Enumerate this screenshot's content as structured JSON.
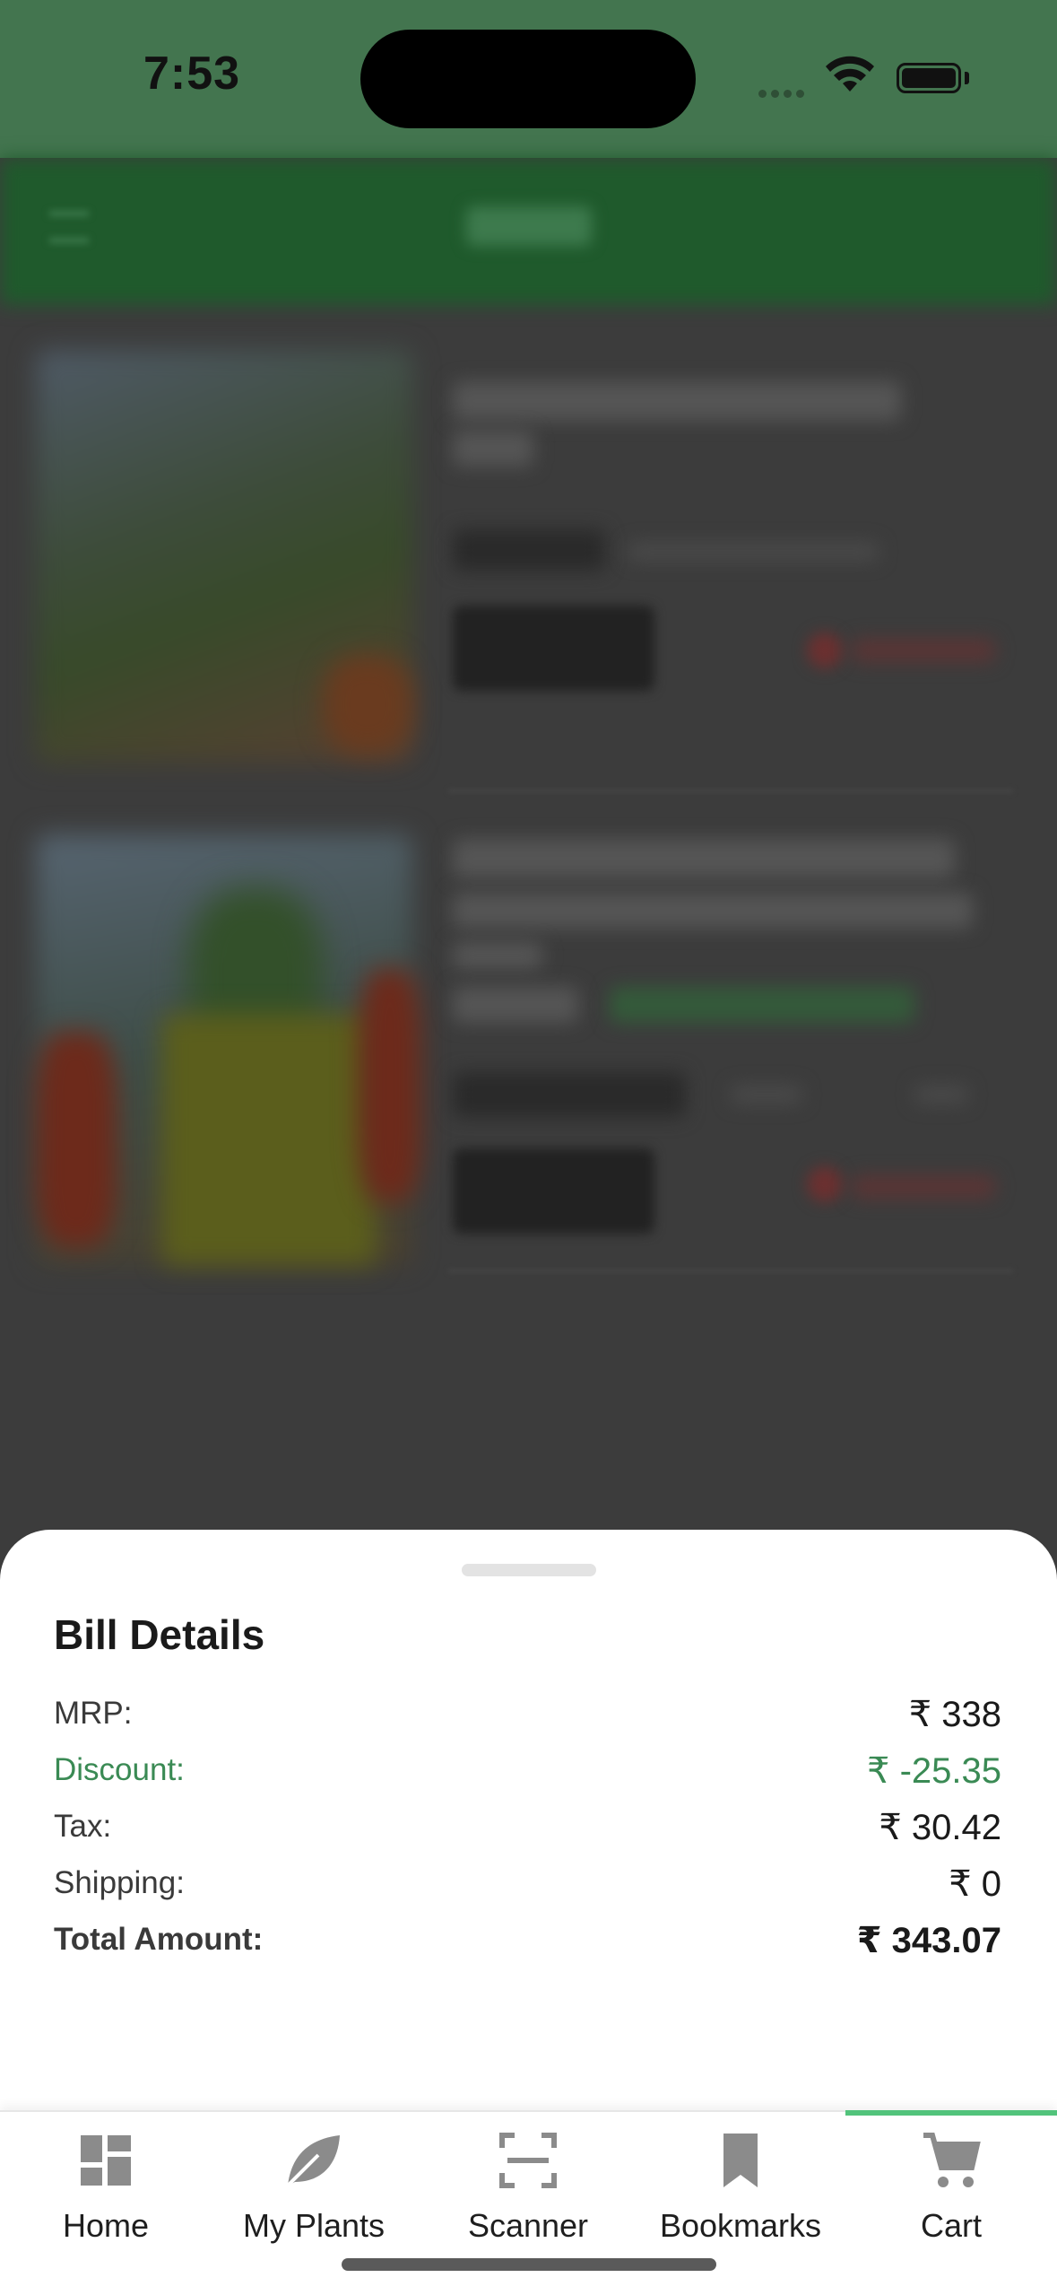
{
  "status_bar": {
    "time": "7:53"
  },
  "bill": {
    "title": "Bill Details",
    "rows": [
      {
        "label": "MRP:",
        "value": "₹ 338"
      },
      {
        "label": "Discount:",
        "value": "₹ -25.35"
      },
      {
        "label": "Tax:",
        "value": "₹ 30.42"
      },
      {
        "label": "Shipping:",
        "value": "₹ 0"
      },
      {
        "label": "Total Amount:",
        "value": "₹ 343.07"
      }
    ]
  },
  "tabs": [
    {
      "label": "Home",
      "icon": "dashboard-icon"
    },
    {
      "label": "My Plants",
      "icon": "leaf-icon"
    },
    {
      "label": "Scanner",
      "icon": "scanner-icon"
    },
    {
      "label": "Bookmarks",
      "icon": "bookmark-icon"
    },
    {
      "label": "Cart",
      "icon": "cart-icon",
      "active": true
    }
  ],
  "colors": {
    "header_green": "#43754f",
    "discount_green": "#3a8a54",
    "active_tab": "#52c37b"
  }
}
